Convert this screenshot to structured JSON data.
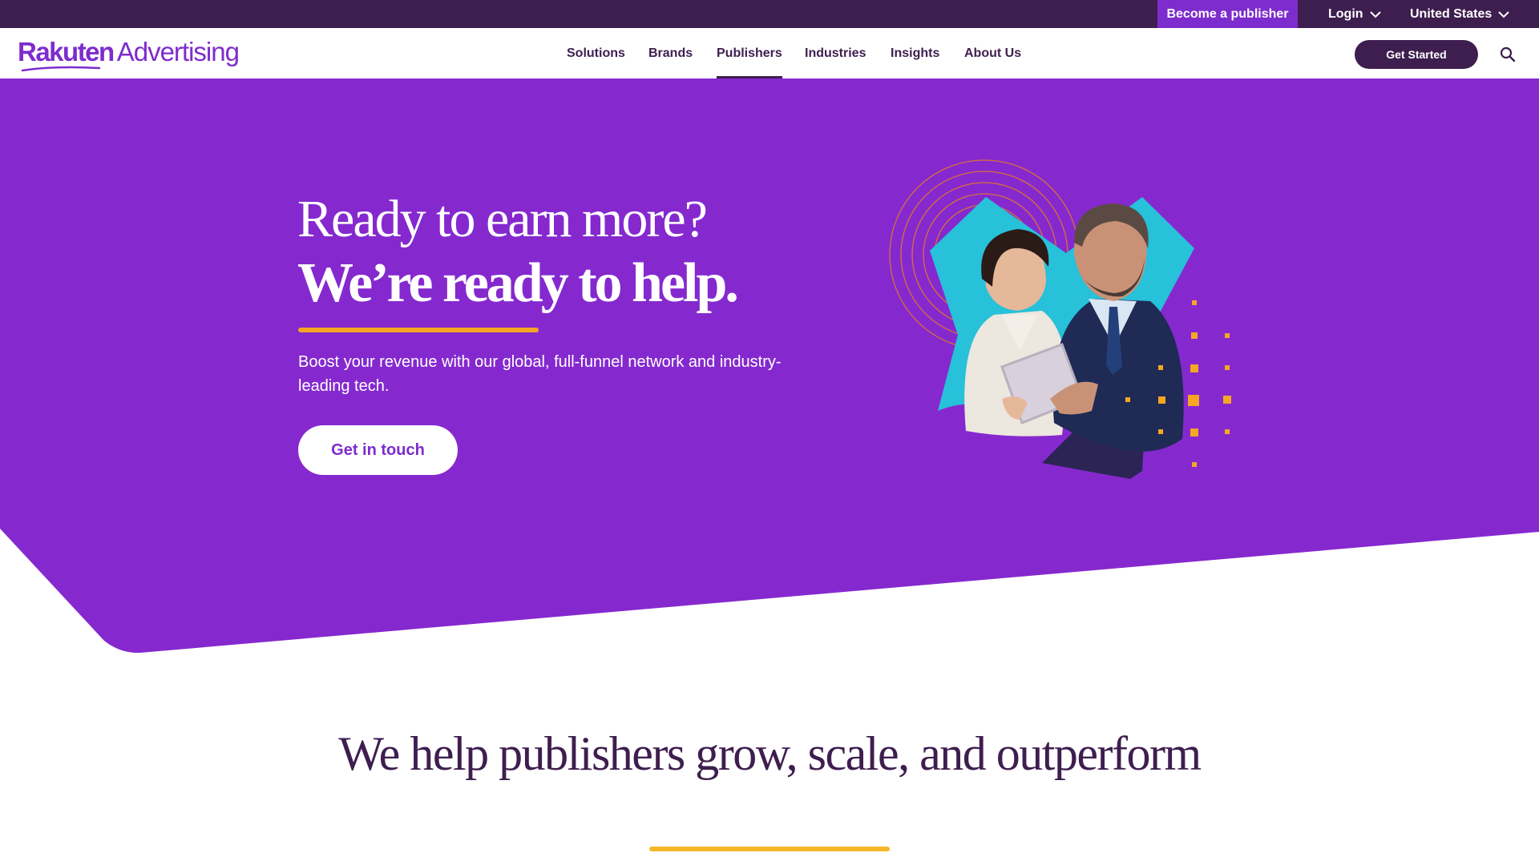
{
  "utility_bar": {
    "become_publisher": "Become a publisher",
    "login": "Login",
    "country": "United States"
  },
  "nav": {
    "logo_primary": "Rakuten",
    "logo_secondary": "Advertising",
    "items": [
      {
        "label": "Solutions"
      },
      {
        "label": "Brands"
      },
      {
        "label": "Publishers",
        "active": true
      },
      {
        "label": "Industries"
      },
      {
        "label": "Insights"
      },
      {
        "label": "About Us"
      }
    ],
    "cta": "Get Started",
    "search_icon": "search-icon"
  },
  "hero": {
    "title_line1": "Ready to earn more?",
    "title_line2": "We’re ready to help.",
    "body": "Boost your revenue with our global, full-funnel network and industry-leading tech.",
    "cta": "Get in touch"
  },
  "section": {
    "title": "We help publishers grow, scale, and outperform"
  },
  "colors": {
    "dark_purple": "#3e1e4f",
    "purple": "#7d2ccd",
    "hero_purple": "#8529cf",
    "accent_orange": "#f6a623",
    "accent_yellow": "#f6b82a",
    "cyan": "#27c1d9"
  }
}
